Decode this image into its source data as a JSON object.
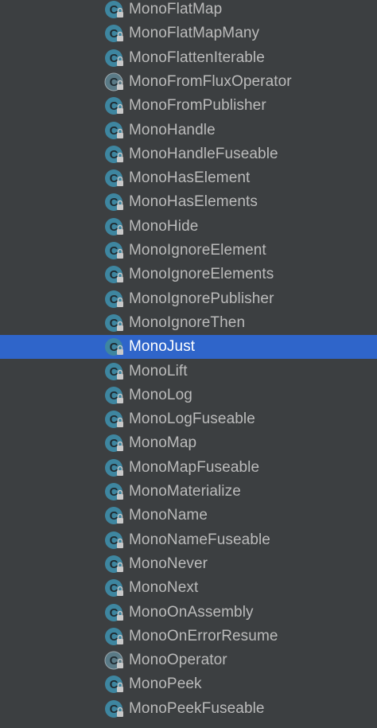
{
  "colors": {
    "background": "#3c3f41",
    "text": "#bbbbbb",
    "selection": "#2f65ca",
    "selected_text": "#ffffff",
    "class_icon": "#3e86a0",
    "abstract_class_icon": "#5a7a86"
  },
  "selected_item": "MonoJust",
  "items": [
    {
      "label": "MonoFlatMap",
      "icon": "class-icon"
    },
    {
      "label": "MonoFlatMapMany",
      "icon": "class-icon"
    },
    {
      "label": "MonoFlattenIterable",
      "icon": "class-icon"
    },
    {
      "label": "MonoFromFluxOperator",
      "icon": "abstract-class-icon"
    },
    {
      "label": "MonoFromPublisher",
      "icon": "class-icon"
    },
    {
      "label": "MonoHandle",
      "icon": "class-icon"
    },
    {
      "label": "MonoHandleFuseable",
      "icon": "class-icon"
    },
    {
      "label": "MonoHasElement",
      "icon": "class-icon"
    },
    {
      "label": "MonoHasElements",
      "icon": "class-icon"
    },
    {
      "label": "MonoHide",
      "icon": "class-icon"
    },
    {
      "label": "MonoIgnoreElement",
      "icon": "class-icon"
    },
    {
      "label": "MonoIgnoreElements",
      "icon": "class-icon"
    },
    {
      "label": "MonoIgnorePublisher",
      "icon": "class-icon"
    },
    {
      "label": "MonoIgnoreThen",
      "icon": "class-icon"
    },
    {
      "label": "MonoJust",
      "icon": "class-icon"
    },
    {
      "label": "MonoLift",
      "icon": "class-icon"
    },
    {
      "label": "MonoLog",
      "icon": "class-icon"
    },
    {
      "label": "MonoLogFuseable",
      "icon": "class-icon"
    },
    {
      "label": "MonoMap",
      "icon": "class-icon"
    },
    {
      "label": "MonoMapFuseable",
      "icon": "class-icon"
    },
    {
      "label": "MonoMaterialize",
      "icon": "class-icon"
    },
    {
      "label": "MonoName",
      "icon": "class-icon"
    },
    {
      "label": "MonoNameFuseable",
      "icon": "class-icon"
    },
    {
      "label": "MonoNever",
      "icon": "class-icon"
    },
    {
      "label": "MonoNext",
      "icon": "class-icon"
    },
    {
      "label": "MonoOnAssembly",
      "icon": "class-icon"
    },
    {
      "label": "MonoOnErrorResume",
      "icon": "class-icon"
    },
    {
      "label": "MonoOperator",
      "icon": "abstract-class-icon"
    },
    {
      "label": "MonoPeek",
      "icon": "class-icon"
    },
    {
      "label": "MonoPeekFuseable",
      "icon": "class-icon"
    }
  ]
}
